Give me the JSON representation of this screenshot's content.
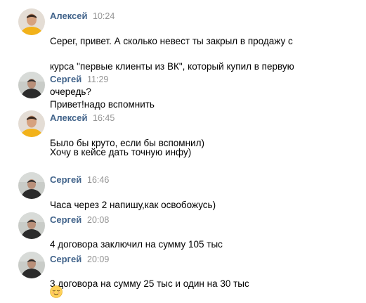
{
  "messages": [
    {
      "author": "Алексей",
      "time": "10:24",
      "avatar": "aleksey",
      "lines": [
        "Серег, привет. А сколько невест ты закрыл в продажу с",
        "курса \"первые клиенты из ВК\", который купил в первую",
        "очередь?"
      ]
    },
    {
      "author": "Сергей",
      "time": "11:29",
      "avatar": "sergey",
      "lines": [
        "Привет!надо вспомнить"
      ]
    },
    {
      "author": "Алексей",
      "time": "16:45",
      "avatar": "aleksey",
      "lines": [
        "Было бы круто, если бы вспомнил)"
      ],
      "extra": "Хочу в кейсе дать точную инфу)"
    },
    {
      "author": "Сергей",
      "time": "16:46",
      "avatar": "sergey",
      "lines": [
        "Часа через 2 напишу,как освобожусь)"
      ]
    },
    {
      "author": "Сергей",
      "time": "20:08",
      "avatar": "sergey",
      "lines": [
        "4 договора заключил на сумму 105 тыс"
      ]
    },
    {
      "author": "Сергей",
      "time": "20:09",
      "avatar": "sergey",
      "lines": [
        "3 договора на сумму 25 тыс и один на 30 тыс"
      ],
      "emoji": "relieved-face-emoji"
    }
  ],
  "colors": {
    "author_name": "#42648b",
    "timestamp": "#939393",
    "text": "#000000"
  }
}
